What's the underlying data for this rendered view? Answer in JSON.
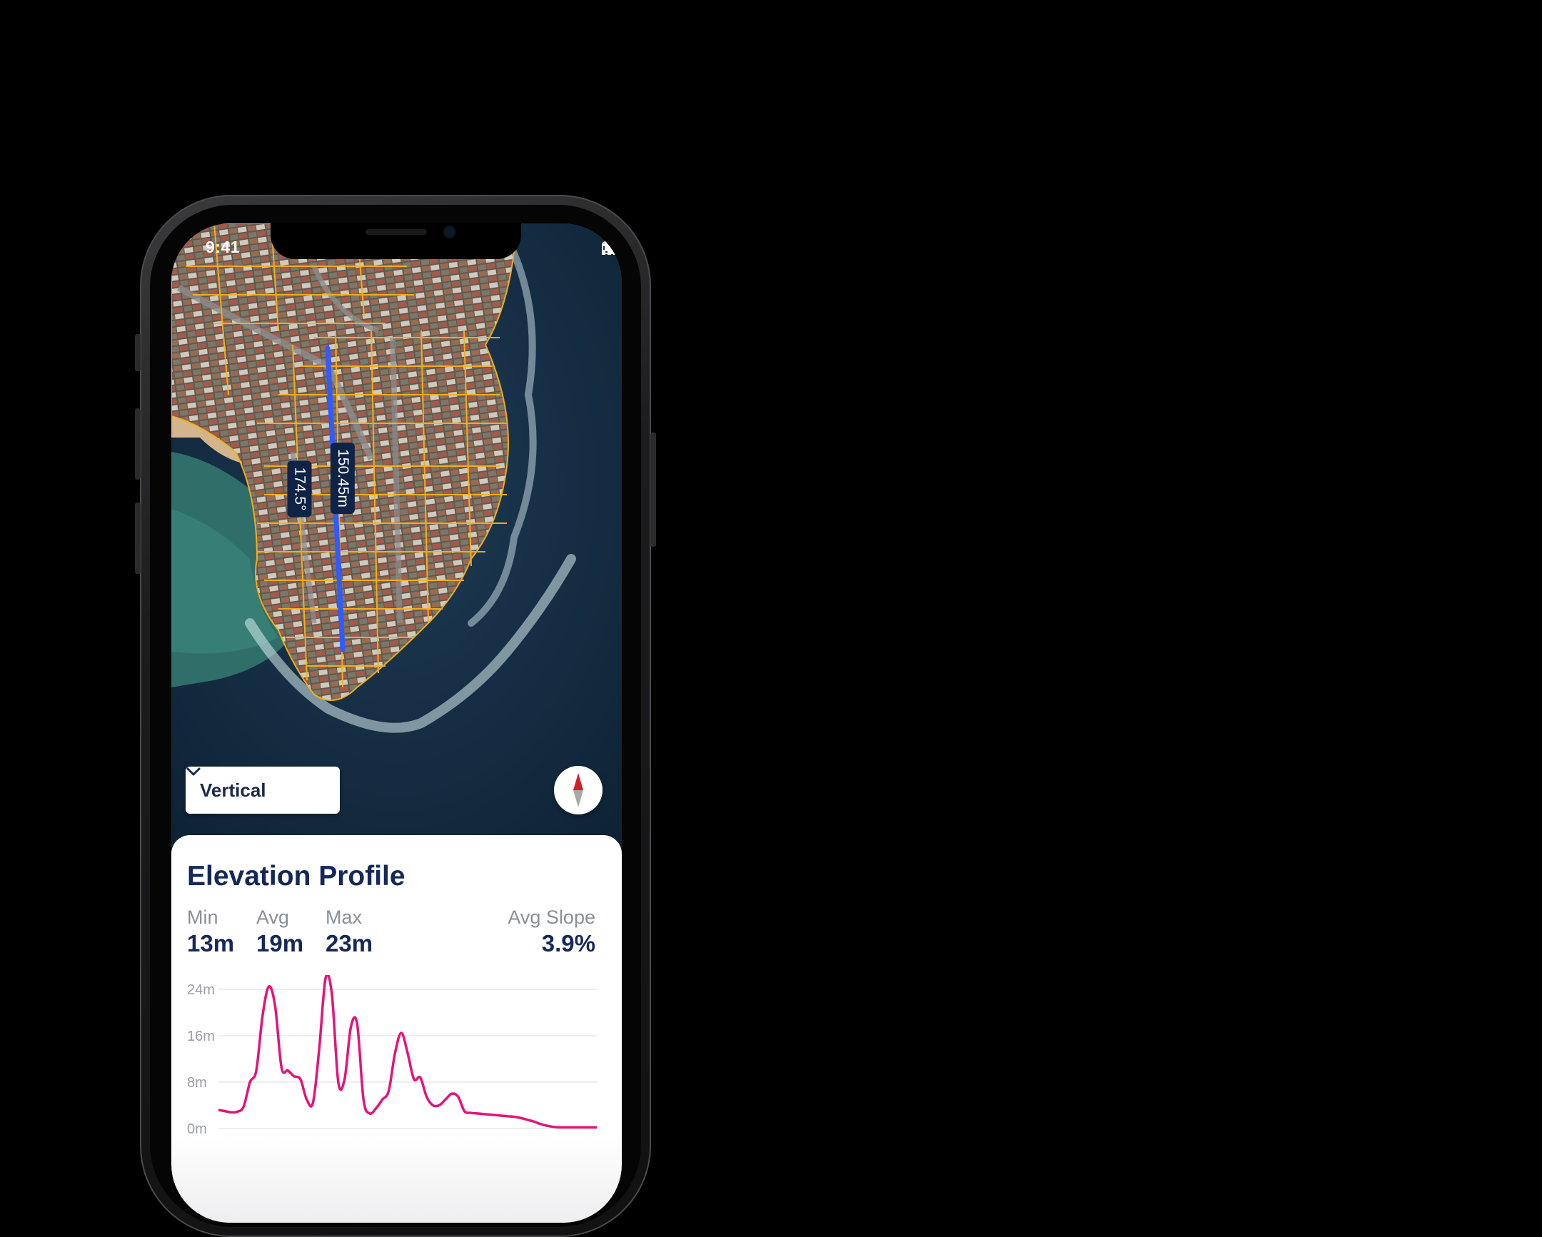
{
  "status_bar": {
    "time": "9:41"
  },
  "map": {
    "distance_label": "150.45m",
    "bearing_label": "174.5°",
    "measure_line_color": "#2f5bff",
    "parcel_color": "#f5b21a"
  },
  "dropdown": {
    "selected": "Vertical",
    "icon": "chevron-down-icon"
  },
  "compass": {
    "icon": "compass-icon"
  },
  "elevation": {
    "title": "Elevation Profile",
    "stats": {
      "min_label": "Min",
      "min_value": "13m",
      "avg_label": "Avg",
      "avg_value": "19m",
      "max_label": "Max",
      "max_value": "23m",
      "slope_label": "Avg Slope",
      "slope_value": "3.9%"
    }
  },
  "chart_data": {
    "type": "line",
    "title": "",
    "xlabel": "",
    "ylabel": "",
    "y_ticks": [
      "24m",
      "16m",
      "8m",
      "0m"
    ],
    "ylim": [
      0,
      24
    ],
    "grid": true,
    "color": "#e3147a",
    "x": [
      0,
      1,
      2,
      3,
      4,
      5,
      6,
      7,
      8,
      9,
      10,
      11,
      12,
      13,
      14,
      15,
      16,
      17,
      18,
      19,
      20,
      21,
      22,
      23,
      24,
      25,
      26,
      27,
      28,
      29,
      30,
      31,
      32,
      33,
      34,
      35,
      36,
      37,
      38,
      39,
      40,
      41,
      42,
      43,
      44,
      45,
      46,
      47,
      48,
      49,
      50,
      51,
      52,
      53,
      54,
      55,
      56,
      57,
      58,
      59,
      60
    ],
    "values": [
      3.2,
      3.0,
      2.8,
      2.9,
      3.8,
      8.0,
      10.0,
      19.5,
      24.5,
      21.0,
      10.5,
      10.0,
      9.0,
      8.5,
      5.0,
      4.5,
      14.0,
      26.0,
      23.0,
      8.0,
      8.5,
      17.5,
      18.0,
      5.0,
      2.6,
      3.5,
      5.0,
      6.5,
      13.0,
      16.5,
      13.0,
      8.5,
      8.8,
      5.5,
      4.0,
      4.0,
      5.0,
      6.0,
      5.5,
      3.0,
      2.7,
      2.6,
      2.5,
      2.4,
      2.3,
      2.2,
      2.1,
      2.0,
      1.8,
      1.5,
      1.2,
      0.8,
      0.5,
      0.3,
      0.2,
      0.2,
      0.2,
      0.2,
      0.2,
      0.2,
      0.2
    ]
  }
}
